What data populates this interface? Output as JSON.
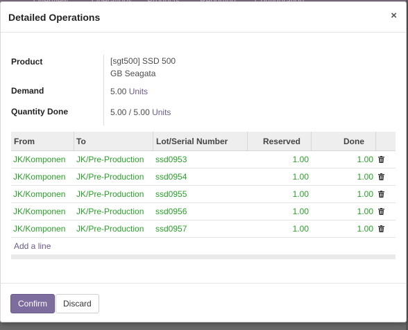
{
  "background": {
    "nav_items": [
      "Overview",
      "Operations",
      "Products",
      "Reporting",
      "Configuration"
    ]
  },
  "modal": {
    "title": "Detailed Operations",
    "close_symbol": "×"
  },
  "info": {
    "product_label": "Product",
    "product_value": "[sgt500] SSD 500 GB Seagata",
    "demand_label": "Demand",
    "demand_qty": "5.00",
    "demand_uom": "Units",
    "qty_done_label": "Quantity Done",
    "qty_done": "5.00",
    "qty_separator": "/",
    "qty_total": "5.00",
    "qty_uom": "Units"
  },
  "table": {
    "columns": [
      "From",
      "To",
      "Lot/Serial Number",
      "Reserved",
      "Done"
    ],
    "rows": [
      {
        "from": "JK/Komponen",
        "to": "JK/Pre-Production",
        "lot": "ssd0953",
        "reserved": "1.00",
        "done": "1.00"
      },
      {
        "from": "JK/Komponen",
        "to": "JK/Pre-Production",
        "lot": "ssd0954",
        "reserved": "1.00",
        "done": "1.00"
      },
      {
        "from": "JK/Komponen",
        "to": "JK/Pre-Production",
        "lot": "ssd0955",
        "reserved": "1.00",
        "done": "1.00"
      },
      {
        "from": "JK/Komponen",
        "to": "JK/Pre-Production",
        "lot": "ssd0956",
        "reserved": "1.00",
        "done": "1.00"
      },
      {
        "from": "JK/Komponen",
        "to": "JK/Pre-Production",
        "lot": "ssd0957",
        "reserved": "1.00",
        "done": "1.00"
      }
    ],
    "add_line_label": "Add a line",
    "row_action_icon": "trash-icon"
  },
  "footer": {
    "confirm_label": "Confirm",
    "discard_label": "Discard"
  },
  "colors": {
    "primary": "#7c6d9e",
    "link": "#6b5b8a",
    "row_text": "#28a028"
  }
}
